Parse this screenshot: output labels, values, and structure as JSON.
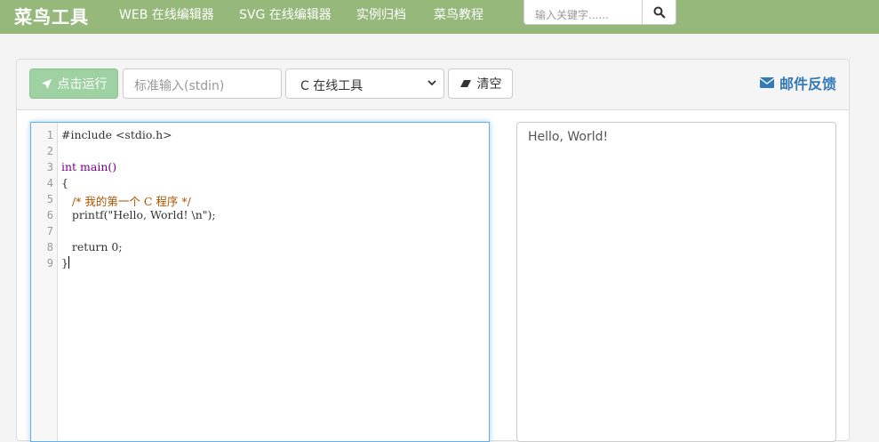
{
  "nav": {
    "brand": "菜鸟工具",
    "links": [
      "WEB 在线编辑器",
      "SVG 在线编辑器",
      "实例归档",
      "菜鸟教程"
    ],
    "search_placeholder": "输入关键字......"
  },
  "toolbar": {
    "run_label": "点击运行",
    "stdin_placeholder": "标准输入(stdin)",
    "language_selected": "C 在线工具",
    "clear_label": "清空",
    "feedback_label": "邮件反馈"
  },
  "editor": {
    "line_numbers": [
      "1",
      "2",
      "3",
      "4",
      "5",
      "6",
      "7",
      "8",
      "9"
    ],
    "lines": [
      "#include <stdio.h>",
      "",
      "int main()",
      "{",
      "   /* 我的第一个 C 程序 */",
      "   printf(\"Hello, World! \\n\");",
      "",
      "   return 0;",
      "}"
    ]
  },
  "output": {
    "text": "Hello, World!"
  },
  "colors": {
    "navbar": "#96b97b",
    "run_button": "#9fd2a3",
    "link_blue": "#337ab7",
    "editor_focus": "#66afe9"
  },
  "icons": [
    "search-icon",
    "send-icon",
    "chevron-down-icon",
    "eraser-icon",
    "envelope-icon"
  ]
}
